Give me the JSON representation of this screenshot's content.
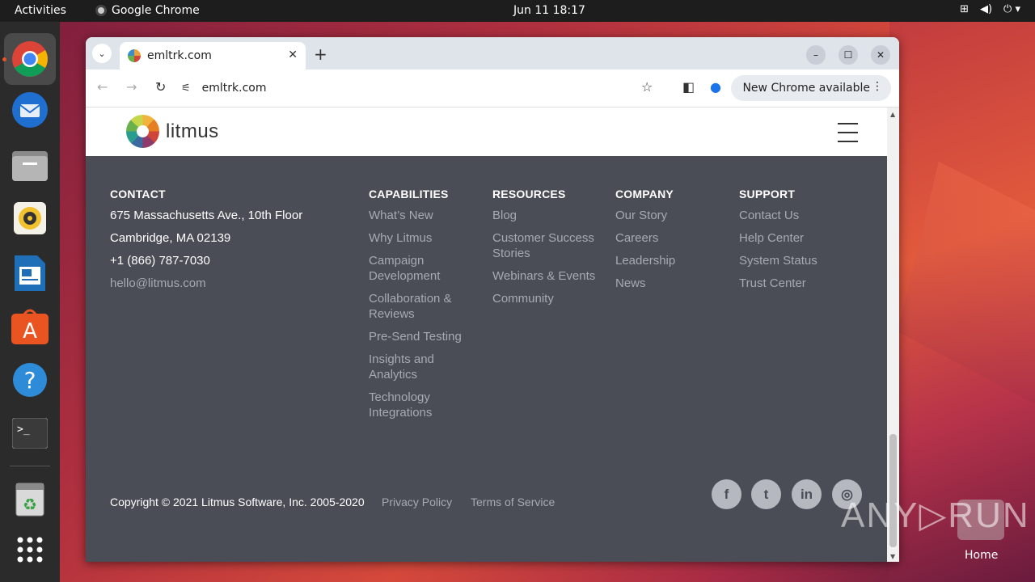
{
  "topbar": {
    "activities": "Activities",
    "app_name": "Google Chrome",
    "clock": "Jun 11  18:17"
  },
  "dock": {
    "items": [
      "chrome-icon",
      "thunderbird-icon",
      "files-icon",
      "rhythmbox-icon",
      "writer-icon",
      "software-icon",
      "help-icon",
      "terminal-icon",
      "trash-icon",
      "apps-grid-icon"
    ]
  },
  "browser": {
    "tab_title": "emltrk.com",
    "url": "emltrk.com",
    "new_chrome": "New Chrome available"
  },
  "site": {
    "logo_text": "litmus",
    "contact": {
      "heading": "CONTACT",
      "address1": "675 Massachusetts Ave., 10th Floor",
      "address2": "Cambridge, MA 02139",
      "phone": "+1 (866) 787-7030",
      "email": "hello@litmus.com"
    },
    "columns": [
      {
        "heading": "CAPABILITIES",
        "links": [
          "What’s New",
          "Why Litmus",
          "Campaign Development",
          "Collaboration & Reviews",
          "Pre-Send Testing",
          "Insights and Analytics",
          "Technology Integrations"
        ]
      },
      {
        "heading": "RESOURCES",
        "links": [
          "Blog",
          "Customer Success Stories",
          "Webinars & Events",
          "Community"
        ]
      },
      {
        "heading": "COMPANY",
        "links": [
          "Our Story",
          "Careers",
          "Leadership",
          "News"
        ]
      },
      {
        "heading": "SUPPORT",
        "links": [
          "Contact Us",
          "Help Center",
          "System Status",
          "Trust Center"
        ]
      }
    ],
    "copyright": "Copyright © 2021 Litmus Software, Inc. 2005-2020",
    "privacy": "Privacy Policy",
    "terms": "Terms of Service",
    "social": {
      "facebook": "f",
      "twitter": "t",
      "linkedin": "in",
      "instagram": "◎"
    }
  },
  "watermark": {
    "text": "ANY▷RUN",
    "home_label": "Home"
  },
  "colors": {
    "footer_bg": "#4a4c56",
    "link": "#a7aab2",
    "accent": "#e95420"
  }
}
